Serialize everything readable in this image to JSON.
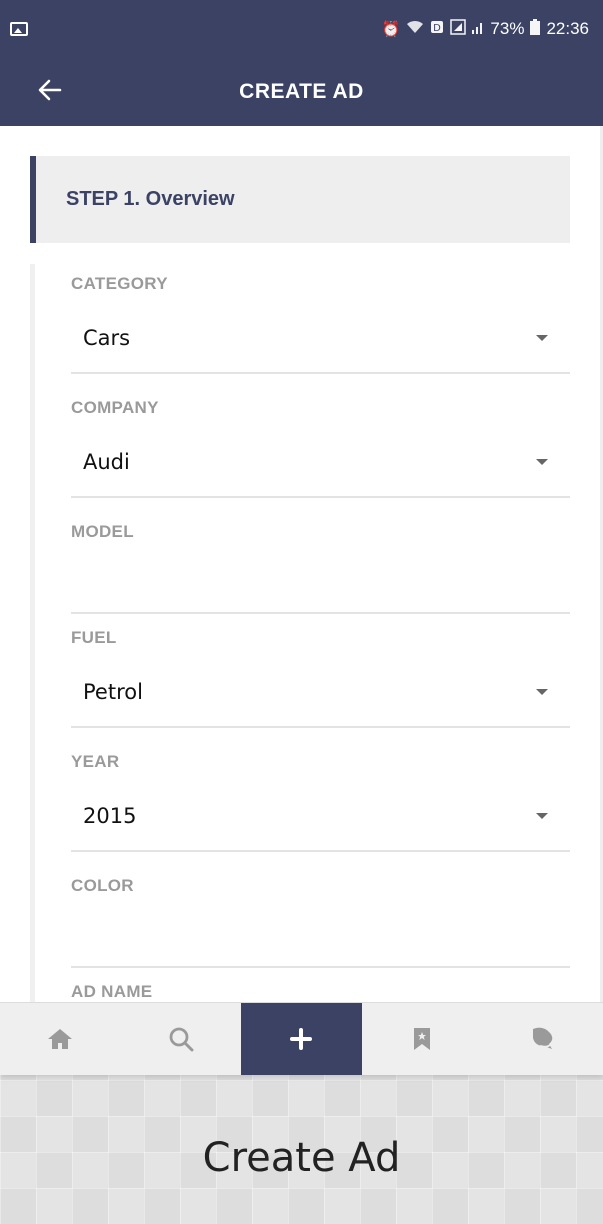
{
  "status_bar": {
    "icons": [
      "image-icon",
      "alarm-icon",
      "wifi-icon",
      "data-icon",
      "sim-icon",
      "signal-icon",
      "battery-icon"
    ],
    "battery": "73%",
    "time": "22:36"
  },
  "app_bar": {
    "title": "CREATE AD",
    "background": "#3b4264"
  },
  "step": {
    "title": "STEP 1. Overview"
  },
  "fields": [
    {
      "label": "CATEGORY",
      "value": "Cars",
      "dropdown": true
    },
    {
      "label": "COMPANY",
      "value": "Audi",
      "dropdown": true
    },
    {
      "label": "MODEL",
      "value": "",
      "dropdown": false
    },
    {
      "label": "FUEL",
      "value": "Petrol",
      "dropdown": true
    },
    {
      "label": "YEAR",
      "value": "2015",
      "dropdown": true
    },
    {
      "label": "COLOR",
      "value": "",
      "dropdown": false
    },
    {
      "label": "AD NAME",
      "value": "",
      "dropdown": false
    }
  ],
  "bottom_nav": {
    "items": [
      "home-icon",
      "search-icon",
      "plus-icon",
      "bookmark-icon",
      "chat-icon"
    ],
    "active": "plus-icon"
  },
  "caption": "Create Ad"
}
